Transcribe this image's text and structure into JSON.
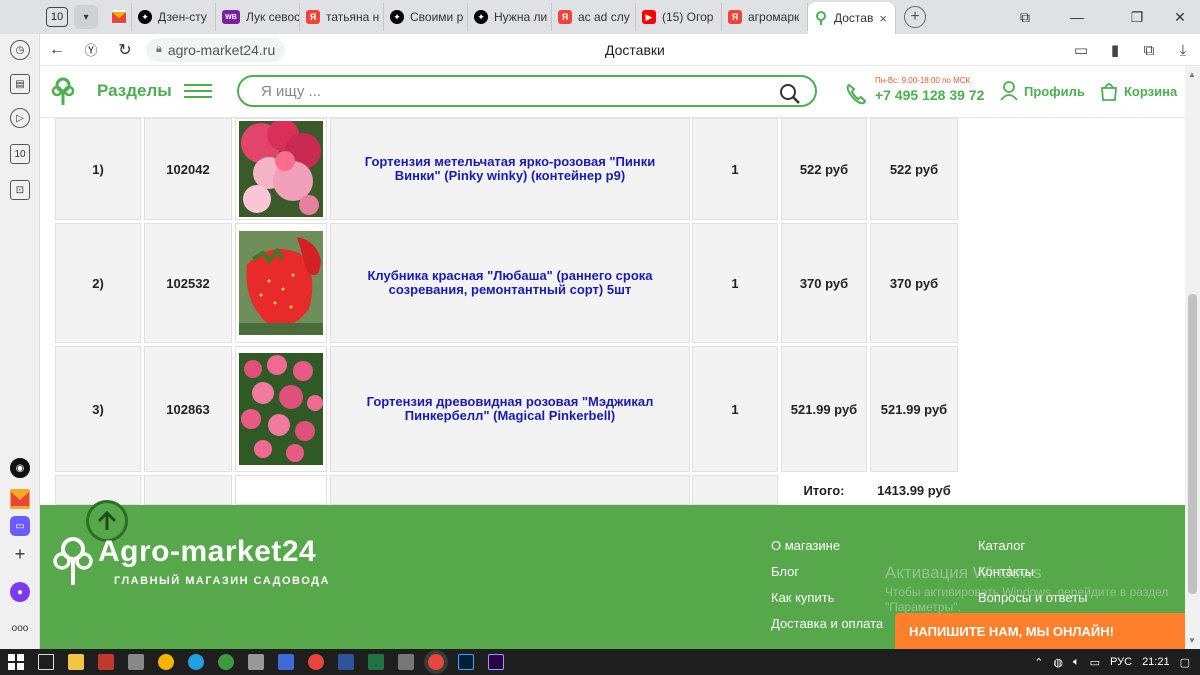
{
  "browser": {
    "tab_count": "10",
    "tabs": [
      {
        "label": "",
        "color": "#e8453c",
        "icon": "mail-icon"
      },
      {
        "label": "Дзен-сту",
        "color": "#000000",
        "icon": "dzen-icon"
      },
      {
        "label": "Лук севос",
        "color": "#7b1fa2",
        "icon": "wb-icon",
        "badge": "WB"
      },
      {
        "label": "татьяна н",
        "color": "#f44336",
        "icon": "yandex-icon",
        "badge": "Я"
      },
      {
        "label": "Своими р",
        "color": "#000000",
        "icon": "dzen-icon"
      },
      {
        "label": "Нужна ли",
        "color": "#000000",
        "icon": "dzen-icon"
      },
      {
        "label": "ас ad слу",
        "color": "#f44336",
        "icon": "yandex-icon",
        "badge": "Я"
      },
      {
        "label": "(15) Огор",
        "color": "#f44336",
        "icon": "youtube-icon"
      },
      {
        "label": "агромарк",
        "color": "#f44336",
        "icon": "yandex-icon",
        "badge": "Я"
      },
      {
        "label": "Достав",
        "color": "#4caf50",
        "icon": "agro-icon",
        "active": true
      }
    ],
    "url": "agro-market24.ru",
    "page_title": "Доставки"
  },
  "header": {
    "sections_label": "Разделы",
    "search_placeholder": "Я ищу ...",
    "phone_hours": "Пн-Вс: 9:00-18:00 по МСК",
    "phone": "+7 495 128 39 72",
    "profile_label": "Профиль",
    "cart_label": "Корзина",
    "accent": "#4caf50"
  },
  "order": {
    "rows": [
      {
        "num": "1)",
        "code": "102042",
        "name": "Гортензия метельчатая ярко-розовая \"Пинки Винки\" (Pinky winky) (контейнер р9)",
        "qty": "1",
        "price": "522 руб",
        "sum": "522 руб",
        "image": "hydrangea-pink"
      },
      {
        "num": "2)",
        "code": "102532",
        "name": "Клубника красная \"Любаша\" (раннего срока созревания, ремонтантный сорт) 5шт",
        "qty": "1",
        "price": "370 руб",
        "sum": "370 руб",
        "image": "strawberry"
      },
      {
        "num": "3)",
        "code": "102863",
        "name": "Гортензия древовидная розовая \"Мэджикал Пинкербелл\" (Magical Pinkerbell)",
        "qty": "1",
        "price": "521.99 руб",
        "sum": "521.99 руб",
        "image": "hydrangea-bush"
      }
    ],
    "total_label": "Итого:",
    "total": "1413.99 руб"
  },
  "footer": {
    "brand": "Agro-market24",
    "tagline": "ГЛАВНЫЙ МАГАЗИН САДОВОДА",
    "links_col1": [
      "О магазине",
      "Блог",
      "Как купить",
      "Доставка и оплата"
    ],
    "links_col2": [
      "Каталог",
      "Контакты",
      "Вопросы и ответы"
    ],
    "activation_title": "Активация Windows",
    "activation_sub": "Чтобы активировать Windows, перейдите в раздел \"Параметры\".",
    "chat_button": "НАПИШИТЕ НАМ, МЫ ОНЛАЙН!",
    "bg": "#56a84a"
  },
  "taskbar": {
    "lang": "РУС",
    "time": "21:21"
  }
}
